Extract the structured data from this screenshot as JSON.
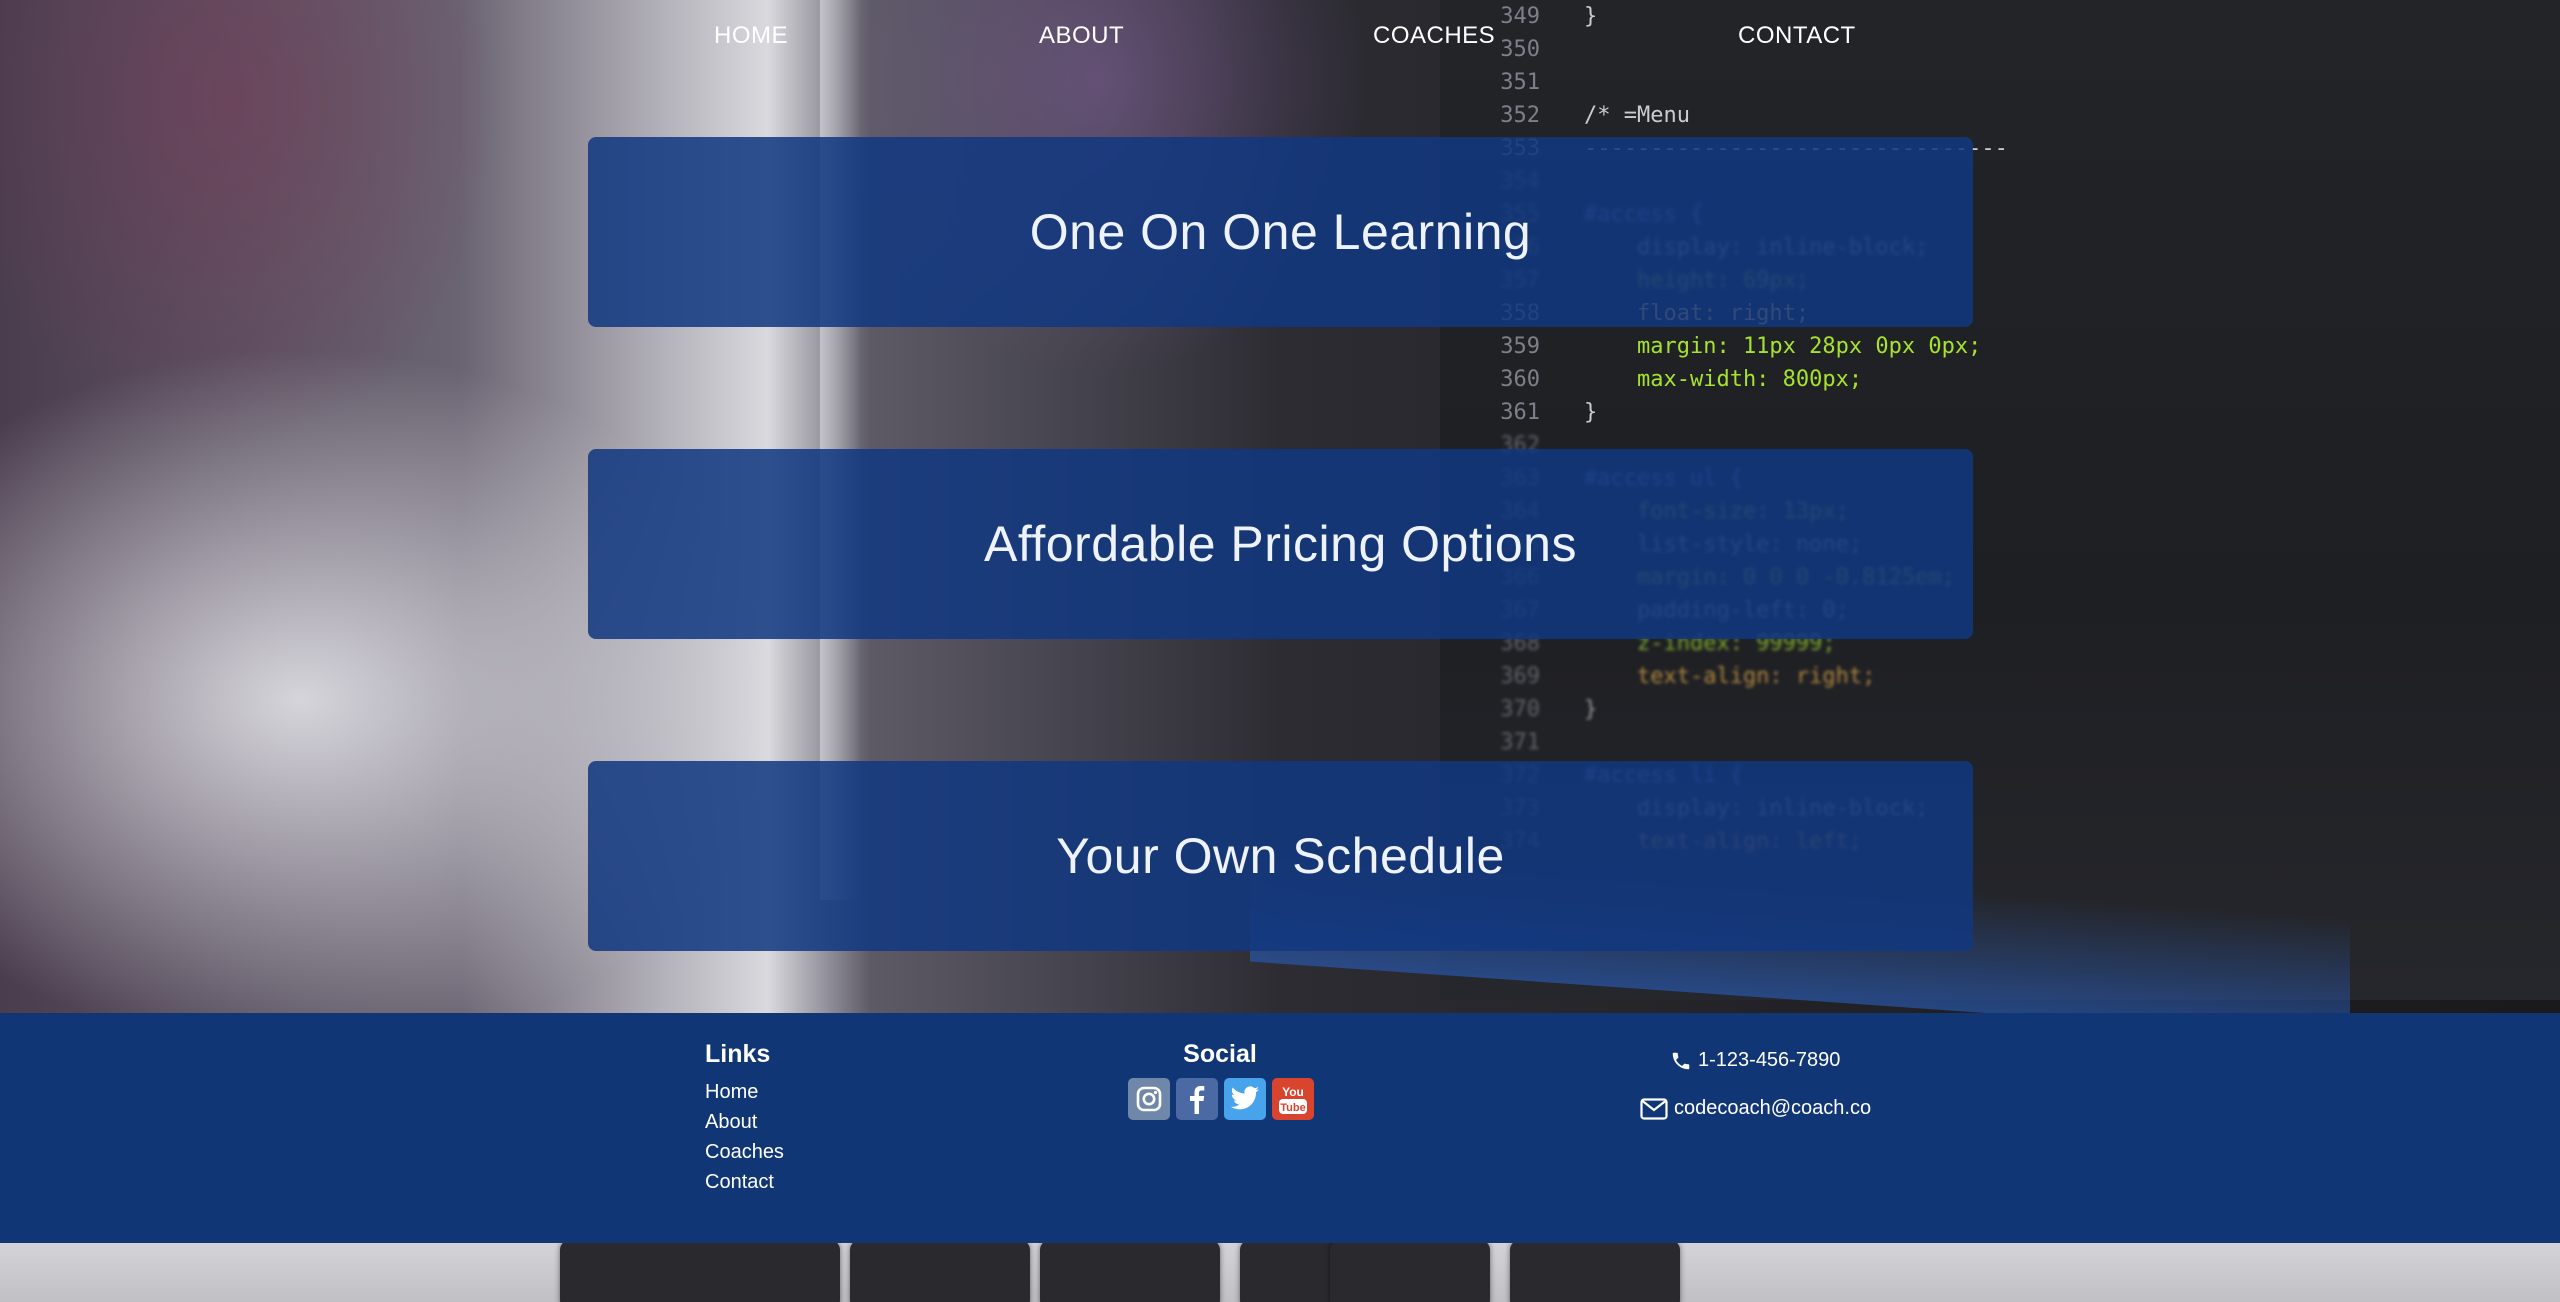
{
  "nav": {
    "items": [
      {
        "label": "HOME"
      },
      {
        "label": "ABOUT"
      },
      {
        "label": "COACHES"
      },
      {
        "label": "CONTACT"
      }
    ]
  },
  "features": [
    {
      "title": "One On One Learning"
    },
    {
      "title": "Affordable Pricing Options"
    },
    {
      "title": "Your Own Schedule"
    }
  ],
  "footer": {
    "links_heading": "Links",
    "links": [
      {
        "label": "Home"
      },
      {
        "label": "About"
      },
      {
        "label": "Coaches"
      },
      {
        "label": "Contact"
      }
    ],
    "social_heading": "Social",
    "social_icons": [
      "instagram-icon",
      "facebook-icon",
      "twitter-icon",
      "youtube-icon"
    ],
    "phone": "1-123-456-7890",
    "email": "codecoach@coach.co",
    "youtube_icon_text": "You Tube"
  },
  "background_code": {
    "lines": [
      {
        "n": "349",
        "t": "}"
      },
      {
        "n": "350",
        "t": ""
      },
      {
        "n": "351",
        "t": ""
      },
      {
        "n": "352",
        "t": "/* =Menu"
      },
      {
        "n": "353",
        "t": "--------------------------------"
      },
      {
        "n": "354",
        "t": ""
      },
      {
        "n": "355",
        "t": "#access {"
      },
      {
        "n": "356",
        "t": "    display: inline-block;"
      },
      {
        "n": "357",
        "t": "    height: 69px;"
      },
      {
        "n": "358",
        "t": "    float: right;"
      },
      {
        "n": "359",
        "t": "    margin: 11px 28px 0px 0px;"
      },
      {
        "n": "360",
        "t": "    max-width: 800px;"
      },
      {
        "n": "361",
        "t": "}"
      },
      {
        "n": "362",
        "t": ""
      },
      {
        "n": "363",
        "t": "#access ul {"
      },
      {
        "n": "364",
        "t": "    font-size: 13px;"
      },
      {
        "n": "365",
        "t": "    list-style: none;"
      },
      {
        "n": "366",
        "t": "    margin: 0 0 0 -0.8125em;"
      },
      {
        "n": "367",
        "t": "    padding-left: 0;"
      },
      {
        "n": "368",
        "t": "    z-index: 99999;"
      },
      {
        "n": "369",
        "t": "    text-align: right;"
      },
      {
        "n": "370",
        "t": "}"
      },
      {
        "n": "371",
        "t": ""
      },
      {
        "n": "372",
        "t": "#access li {"
      },
      {
        "n": "373",
        "t": "    display: inline-block;"
      },
      {
        "n": "374",
        "t": "    text-align: left;"
      }
    ]
  }
}
